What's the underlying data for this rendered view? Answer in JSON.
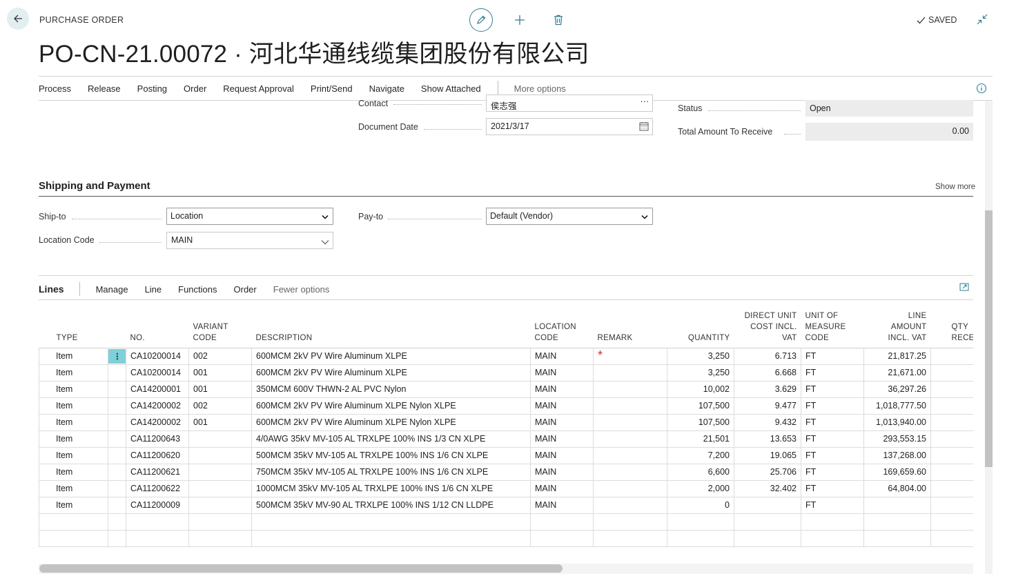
{
  "header": {
    "page_kind": "PURCHASE ORDER",
    "title": "PO-CN-21.00072 · 河北华通线缆集团股份有限公司",
    "saved_label": "SAVED",
    "accent_color": "#2f7f8e"
  },
  "actions": {
    "items": [
      "Process",
      "Release",
      "Posting",
      "Order",
      "Request Approval",
      "Print/Send",
      "Navigate",
      "Show Attached"
    ],
    "more": "More options"
  },
  "general": {
    "contact_label": "Contact",
    "contact_value": "侯志强",
    "document_date_label": "Document Date",
    "document_date_value": "2021/3/17",
    "status_label": "Status",
    "status_value": "Open",
    "total_label": "Total Amount To Receive",
    "total_value": "0.00"
  },
  "shipping": {
    "section_title": "Shipping and Payment",
    "show_more": "Show more",
    "ship_to_label": "Ship-to",
    "ship_to_value": "Location",
    "location_code_label": "Location Code",
    "location_code_value": "MAIN",
    "pay_to_label": "Pay-to",
    "pay_to_value": "Default (Vendor)"
  },
  "lines": {
    "title": "Lines",
    "menu": [
      "Manage",
      "Line",
      "Functions",
      "Order"
    ],
    "fewer": "Fewer options",
    "columns": {
      "type": "TYPE",
      "no": "NO.",
      "variant_1": "VARIANT",
      "variant_2": "CODE",
      "description": "DESCRIPTION",
      "location_1": "LOCATION",
      "location_2": "CODE",
      "remark": "REMARK",
      "quantity": "QUANTITY",
      "cost_1": "DIRECT UNIT",
      "cost_2": "COST INCL.",
      "cost_3": "VAT",
      "uom_1": "UNIT OF",
      "uom_2": "MEASURE",
      "uom_3": "CODE",
      "amount_1": "LINE",
      "amount_2": "AMOUNT",
      "amount_3": "INCL. VAT",
      "qty_rec_1": "QTY",
      "qty_rec_2": "RECE"
    },
    "rows": [
      {
        "type": "Item",
        "no": "CA10200014",
        "variant": "002",
        "description": "600MCM 2kV PV Wire Aluminum XLPE",
        "location": "MAIN",
        "remark": "*",
        "quantity": "3,250",
        "cost": "6.713",
        "uom": "FT",
        "amount": "21,817.25"
      },
      {
        "type": "Item",
        "no": "CA10200014",
        "variant": "001",
        "description": "600MCM 2kV PV Wire Aluminum XLPE",
        "location": "MAIN",
        "remark": "",
        "quantity": "3,250",
        "cost": "6.668",
        "uom": "FT",
        "amount": "21,671.00"
      },
      {
        "type": "Item",
        "no": "CA14200001",
        "variant": "001",
        "description": "350MCM 600V THWN-2 AL PVC Nylon",
        "location": "MAIN",
        "remark": "",
        "quantity": "10,002",
        "cost": "3.629",
        "uom": "FT",
        "amount": "36,297.26"
      },
      {
        "type": "Item",
        "no": "CA14200002",
        "variant": "002",
        "description": "600MCM 2kV PV Wire Aluminum XLPE Nylon XLPE",
        "location": "MAIN",
        "remark": "",
        "quantity": "107,500",
        "cost": "9.477",
        "uom": "FT",
        "amount": "1,018,777.50"
      },
      {
        "type": "Item",
        "no": "CA14200002",
        "variant": "001",
        "description": "600MCM 2kV PV Wire Aluminum XLPE Nylon XLPE",
        "location": "MAIN",
        "remark": "",
        "quantity": "107,500",
        "cost": "9.432",
        "uom": "FT",
        "amount": "1,013,940.00"
      },
      {
        "type": "Item",
        "no": "CA11200643",
        "variant": "",
        "description": "4/0AWG 35kV MV-105 AL TRXLPE 100% INS 1/3 CN XLPE",
        "location": "MAIN",
        "remark": "",
        "quantity": "21,501",
        "cost": "13.653",
        "uom": "FT",
        "amount": "293,553.15"
      },
      {
        "type": "Item",
        "no": "CA11200620",
        "variant": "",
        "description": "500MCM 35kV MV-105 AL TRXLPE 100% INS 1/6 CN XLPE",
        "location": "MAIN",
        "remark": "",
        "quantity": "7,200",
        "cost": "19.065",
        "uom": "FT",
        "amount": "137,268.00"
      },
      {
        "type": "Item",
        "no": "CA11200621",
        "variant": "",
        "description": "750MCM 35kV MV-105 AL TRXLPE 100% INS 1/6 CN XLPE",
        "location": "MAIN",
        "remark": "",
        "quantity": "6,600",
        "cost": "25.706",
        "uom": "FT",
        "amount": "169,659.60"
      },
      {
        "type": "Item",
        "no": "CA11200622",
        "variant": "",
        "description": "1000MCM 35kV MV-105 AL TRXLPE 100% INS 1/6 CN XLPE",
        "location": "MAIN",
        "remark": "",
        "quantity": "2,000",
        "cost": "32.402",
        "uom": "FT",
        "amount": "64,804.00"
      },
      {
        "type": "Item",
        "no": "CA11200009",
        "variant": "",
        "description": "500MCM 35kV MV-90 AL TRXLPE 100% INS 1/12 CN LLDPE",
        "location": "MAIN",
        "remark": "",
        "quantity": "0",
        "cost": "",
        "uom": "FT",
        "amount": ""
      },
      {
        "type": "",
        "no": "",
        "variant": "",
        "description": "",
        "location": "",
        "remark": "",
        "quantity": "",
        "cost": "",
        "uom": "",
        "amount": ""
      },
      {
        "type": "",
        "no": "",
        "variant": "",
        "description": "",
        "location": "",
        "remark": "",
        "quantity": "",
        "cost": "",
        "uom": "",
        "amount": ""
      }
    ]
  }
}
